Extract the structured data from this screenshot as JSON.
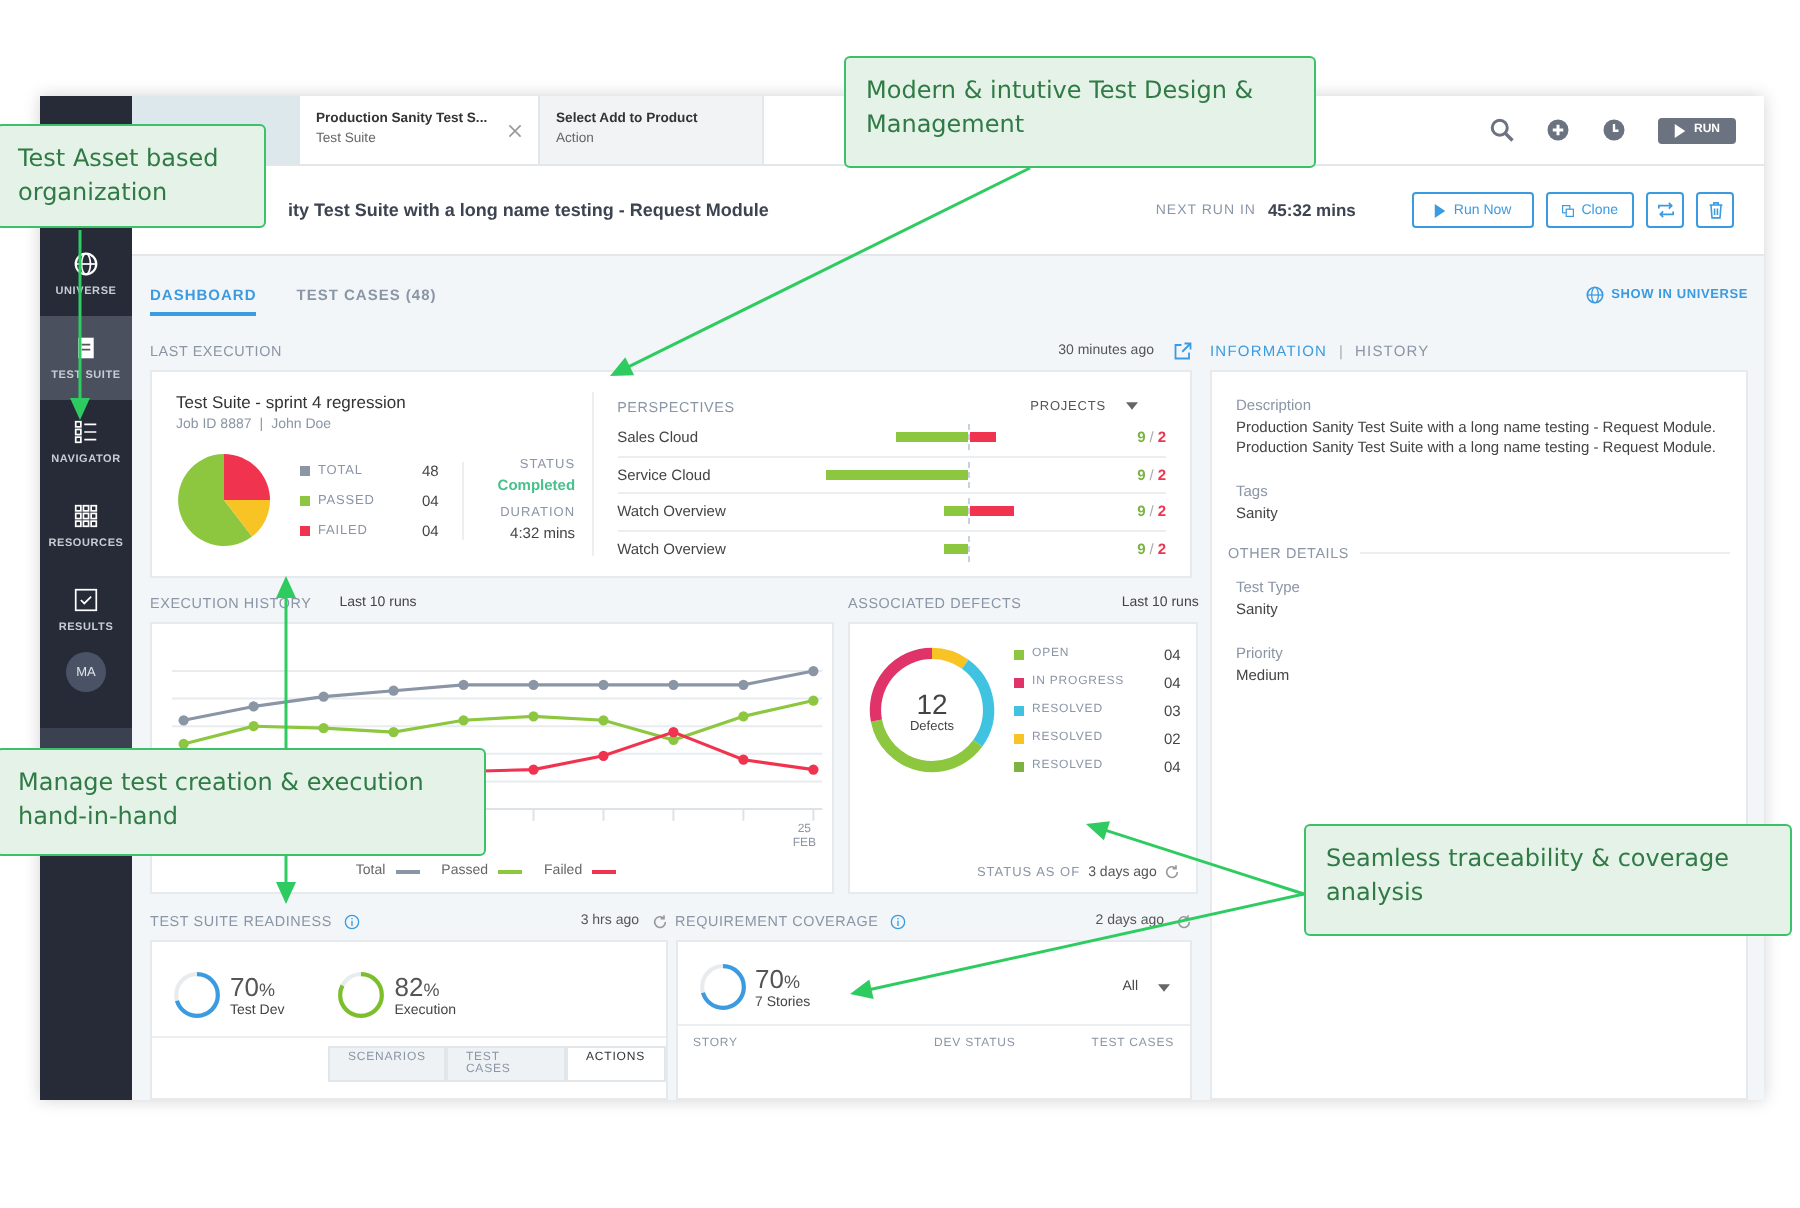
{
  "callouts": [
    {
      "text": "Test Asset based organization"
    },
    {
      "text": "Modern & intutive Test Design & Management"
    },
    {
      "text": "Manage test creation & execution hand-in-hand"
    },
    {
      "text": "Seamless traceability & coverage analysis"
    }
  ],
  "sidebar": {
    "items": [
      {
        "label": "UNIVERSE",
        "selected": false
      },
      {
        "label": "TEST SUITE",
        "selected": true
      },
      {
        "label": "NAVIGATOR",
        "selected": false
      },
      {
        "label": "RESOURCES",
        "selected": false
      },
      {
        "label": "RESULTS",
        "selected": false
      }
    ],
    "avatar": "MA"
  },
  "tabs": [
    {
      "title": "Production Sanity Test S...",
      "subtitle": "Test Suite",
      "selected": true,
      "closable": true
    },
    {
      "title": "Select Add to Product",
      "subtitle": "Action",
      "selected": false,
      "closable": false
    }
  ],
  "toolbar": {
    "run_button": "RUN"
  },
  "header": {
    "title": "ity Test Suite with a long name testing - Request Module",
    "next_run_label": "NEXT RUN IN",
    "next_run_value": "45:32 mins",
    "run_now": "Run Now",
    "clone": "Clone"
  },
  "nav_tabs": [
    {
      "label": "DASHBOARD",
      "selected": true
    },
    {
      "label": "TEST CASES (48)",
      "selected": false
    }
  ],
  "show_in_universe": "SHOW IN UNIVERSE",
  "last_execution": {
    "heading": "LAST EXECUTION",
    "time": "30 minutes ago",
    "suite": "Test Suite - sprint 4 regression",
    "job": "Job ID 8887",
    "job_sep": "|",
    "user": "John Doe",
    "legend": [
      {
        "label": "TOTAL",
        "value": "48",
        "color": "#8a95a5"
      },
      {
        "label": "PASSED",
        "value": "04",
        "color": "#8dc63f"
      },
      {
        "label": "FAILED",
        "value": "04",
        "color": "#f0334f"
      }
    ],
    "status_label": "STATUS",
    "status": "Completed",
    "duration_label": "DURATION",
    "duration": "4:32 mins",
    "perspectives": {
      "heading": "PERSPECTIVES",
      "filter": "PROJECTS",
      "rows": [
        {
          "name": "Sales Cloud",
          "pass_count": "9",
          "sep": "/",
          "fail_count": "2"
        },
        {
          "name": "Service Cloud",
          "pass_count": "9",
          "sep": "/",
          "fail_count": "2"
        },
        {
          "name": "Watch Overview",
          "pass_count": "9",
          "sep": "/",
          "fail_count": "2"
        },
        {
          "name": "Watch Overview",
          "pass_count": "9",
          "sep": "/",
          "fail_count": "2"
        }
      ]
    }
  },
  "execution_history": {
    "heading": "EXECUTION HISTORY",
    "sub": "Last 10 runs",
    "x_day": "25",
    "x_month": "FEB",
    "legend": [
      {
        "label": "Total",
        "color": "#8a95a5"
      },
      {
        "label": "Passed",
        "color": "#8dc63f"
      },
      {
        "label": "Failed",
        "color": "#f0334f"
      }
    ]
  },
  "defects": {
    "heading": "ASSOCIATED DEFECTS",
    "sub": "Last 10 runs",
    "total": "12",
    "total_label": "Defects",
    "legend": [
      {
        "label": "OPEN",
        "value": "04",
        "color": "#8dc63f"
      },
      {
        "label": "IN PROGRESS",
        "value": "04",
        "color": "#e0336a"
      },
      {
        "label": "RESOLVED",
        "value": "03",
        "color": "#3fc3e0"
      },
      {
        "label": "RESOLVED",
        "value": "02",
        "color": "#f7c325"
      },
      {
        "label": "RESOLVED",
        "value": "04",
        "color": "#7cb342"
      }
    ],
    "status_label": "STATUS AS OF",
    "status_time": "3 days ago"
  },
  "readiness": {
    "heading": "TEST SUITE READINESS",
    "time": "3 hrs ago",
    "rings": [
      {
        "value": "70",
        "unit": "%",
        "label": "Test Dev",
        "level": 0.7,
        "color": "#3a9be0"
      },
      {
        "value": "82",
        "unit": "%",
        "label": "Execution",
        "level": 0.82,
        "color": "#7cbf2a"
      }
    ],
    "tabs": [
      {
        "label": "SCENARIOS",
        "selected": false
      },
      {
        "label": "TEST CASES",
        "selected": false
      },
      {
        "label": "ACTIONS",
        "selected": true
      }
    ]
  },
  "coverage": {
    "heading": "REQUIREMENT COVERAGE",
    "time": "2 days ago",
    "ring": {
      "value": "70",
      "unit": "%",
      "label": "7 Stories",
      "level": 0.7,
      "color": "#3a9be0"
    },
    "filter": "All",
    "columns": [
      "STORY",
      "DEV STATUS",
      "TEST CASES"
    ]
  },
  "info": {
    "tabs": [
      {
        "label": "INFORMATION",
        "selected": true
      },
      {
        "label": "HISTORY",
        "selected": false
      }
    ],
    "tab_sep": "|",
    "fields": [
      {
        "label": "Description",
        "value": "Production Sanity Test Suite with a long name testing - Request Module. Production Sanity Test Suite with a long name testing - Request Module."
      },
      {
        "label": "Tags",
        "value": "Sanity"
      }
    ],
    "section": "OTHER DETAILS",
    "details": [
      {
        "label": "Test Type",
        "value": "Sanity"
      },
      {
        "label": "Priority",
        "value": "Medium"
      }
    ]
  }
}
